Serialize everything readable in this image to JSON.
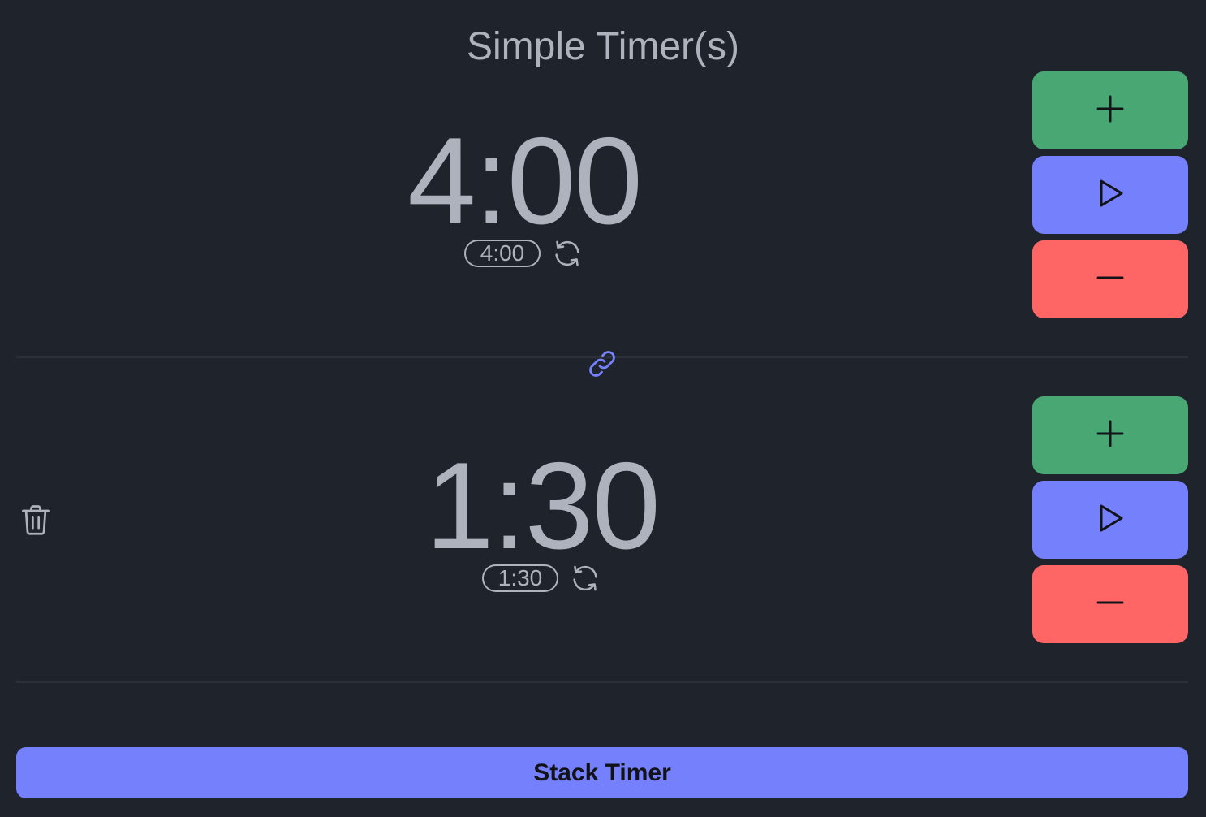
{
  "app": {
    "title": "Simple Timer(s)"
  },
  "timers": [
    {
      "display": "4:00",
      "preset": "4:00",
      "icons": {
        "reset": "refresh-icon",
        "add": "plus-icon",
        "play": "play-icon",
        "subtract": "minus-icon"
      }
    },
    {
      "display": "1:30",
      "preset": "1:30",
      "icons": {
        "reset": "refresh-icon",
        "add": "plus-icon",
        "play": "play-icon",
        "subtract": "minus-icon",
        "delete": "trash-icon"
      }
    }
  ],
  "link": {
    "icon": "link-icon"
  },
  "actions": {
    "stack_label": "Stack Timer"
  },
  "colors": {
    "background": "#1f232b",
    "text": "#aeb2bd",
    "add": "#48a773",
    "play": "#7580fd",
    "subtract": "#fe6565",
    "link": "#7580fd",
    "divider": "#2b303a"
  }
}
